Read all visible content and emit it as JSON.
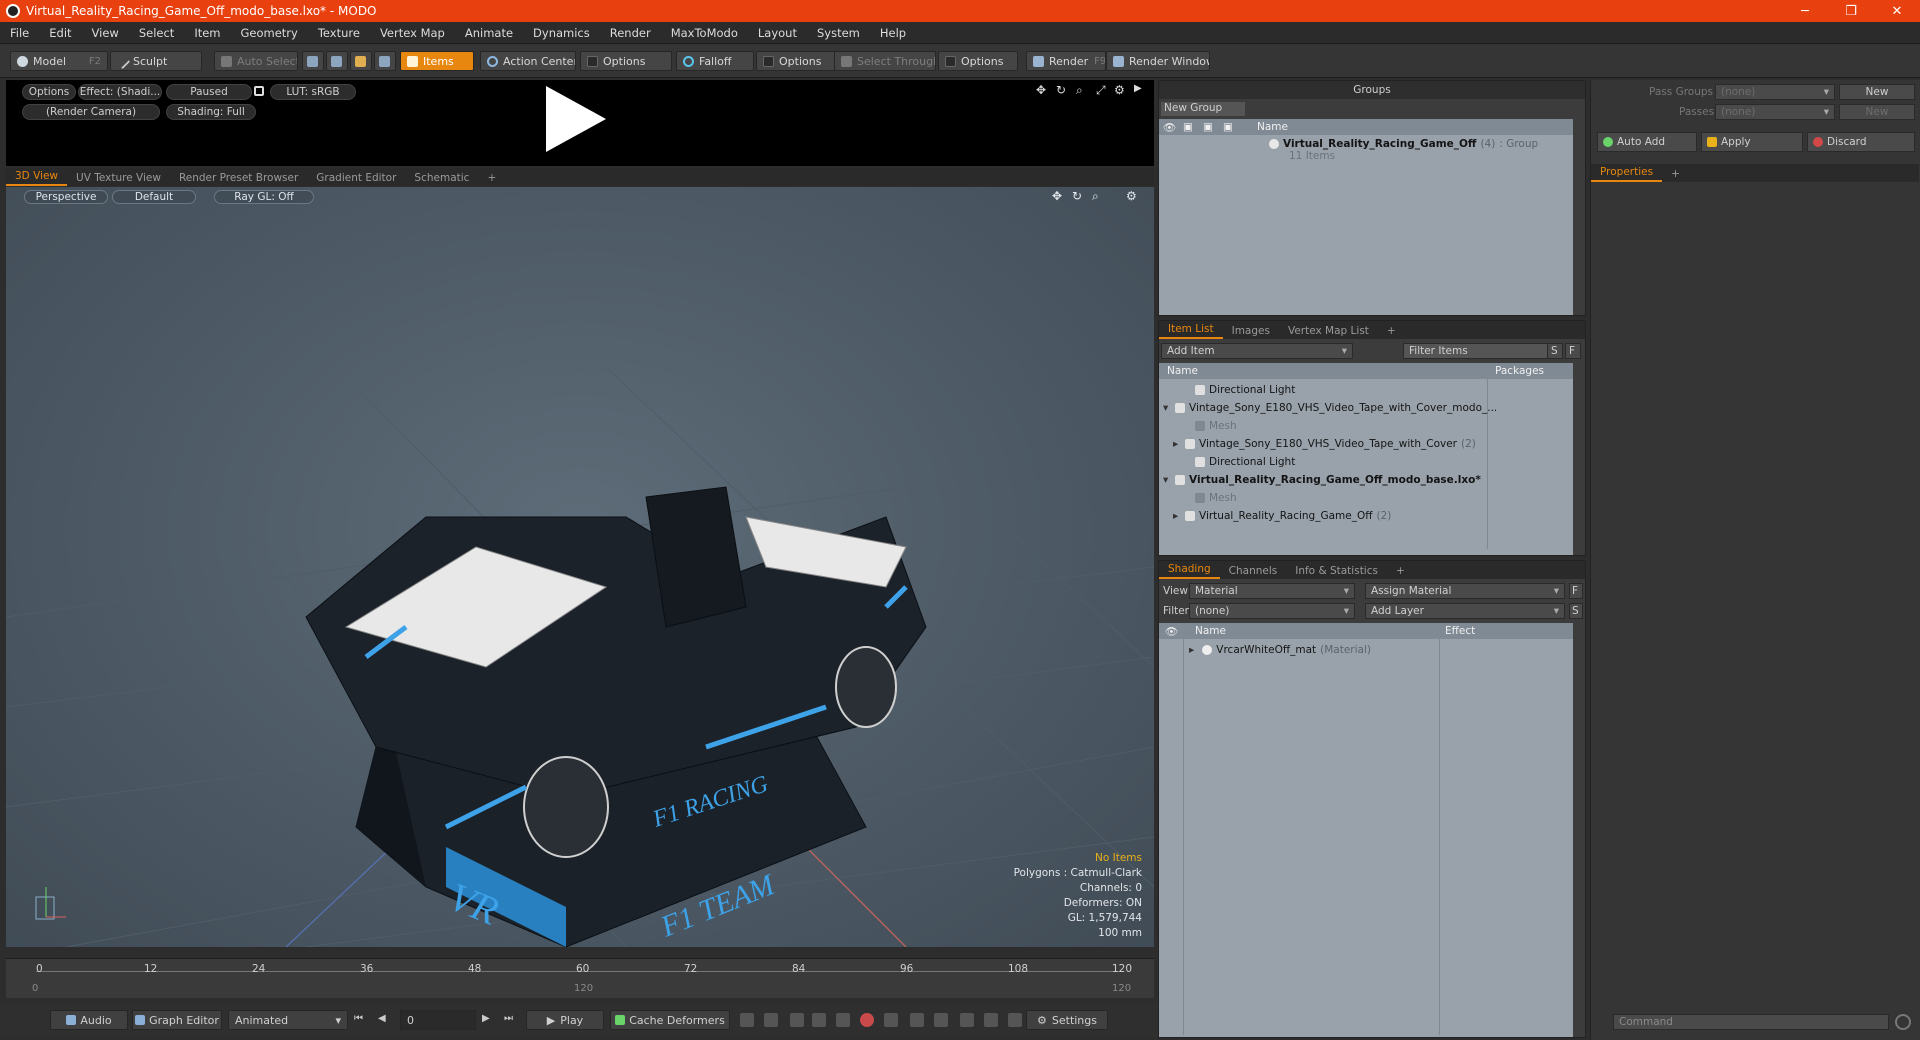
{
  "window": {
    "title": "Virtual_Reality_Racing_Game_Off_modo_base.lxo* - MODO",
    "minimize": "─",
    "maximize": "❐",
    "close": "✕"
  },
  "menu": [
    "File",
    "Edit",
    "View",
    "Select",
    "Item",
    "Geometry",
    "Texture",
    "Vertex Map",
    "Animate",
    "Dynamics",
    "Render",
    "MaxToModo",
    "Layout",
    "System",
    "Help"
  ],
  "toolbar": {
    "model": "Model",
    "model_key": "F2",
    "sculpt": "Sculpt",
    "auto_select": "Auto Select",
    "items": "Items",
    "action_center": "Action Center",
    "options1": "Options",
    "falloff": "Falloff",
    "options2": "Options",
    "select_through": "Select Through",
    "options3": "Options",
    "render": "Render",
    "render_key": "F9",
    "render_window": "Render Window"
  },
  "preview": {
    "options": "Options",
    "effect": "Effect: (Shadi...",
    "paused": "Paused",
    "lut": "LUT: sRGB",
    "camera": "(Render Camera)",
    "shading": "Shading: Full"
  },
  "view_tabs": [
    "3D View",
    "UV Texture View",
    "Render Preset Browser",
    "Gradient Editor",
    "Schematic",
    "+"
  ],
  "viewport": {
    "perspective": "Perspective",
    "default": "Default",
    "raygl": "Ray GL: Off",
    "no_items": "No Items",
    "polygons": "Polygons : Catmull-Clark",
    "channels": "Channels: 0",
    "deformers": "Deformers: ON",
    "gl": "GL: 1,579,744",
    "scale": "100 mm",
    "model_text_1": "F1 RACING",
    "model_text_2": "VR",
    "model_text_3": "F1 TEAM"
  },
  "timeline": {
    "ticks": [
      "0",
      "12",
      "24",
      "36",
      "48",
      "60",
      "72",
      "84",
      "96",
      "108",
      "120"
    ],
    "sub_start": "0",
    "sub_mid": "120",
    "sub_end": "120"
  },
  "bottom": {
    "audio": "Audio",
    "graph_editor": "Graph Editor",
    "animated": "Animated",
    "frame": "0",
    "play": "Play",
    "cache_deformers": "Cache Deformers",
    "settings": "Settings"
  },
  "groups": {
    "title": "Groups",
    "new_group": "New Group",
    "col_name": "Name",
    "group_name": "Virtual_Reality_Racing_Game_Off",
    "group_count": "(4)",
    "group_type": ": Group",
    "group_items": "11 Items"
  },
  "item_list": {
    "tabs": [
      "Item List",
      "Images",
      "Vertex Map List",
      "+"
    ],
    "add_item": "Add Item",
    "filter": "Filter Items",
    "s": "S",
    "f": "F",
    "col_name": "Name",
    "col_packages": "Packages",
    "rows": [
      {
        "label": "Directional Light",
        "indent": 2,
        "style": "normal",
        "arrow": ""
      },
      {
        "label": "Vintage_Sony_E180_VHS_Video_Tape_with_Cover_modo_...",
        "indent": 0,
        "style": "normal",
        "arrow": "▾"
      },
      {
        "label": "Mesh",
        "indent": 2,
        "style": "grey",
        "arrow": ""
      },
      {
        "label": "Vintage_Sony_E180_VHS_Video_Tape_with_Cover",
        "indent": 1,
        "style": "normal",
        "arrow": "▸",
        "suffix": "(2)"
      },
      {
        "label": "Directional Light",
        "indent": 2,
        "style": "normal",
        "arrow": ""
      },
      {
        "label": "Virtual_Reality_Racing_Game_Off_modo_base.lxo*",
        "indent": 0,
        "style": "bold",
        "arrow": "▾"
      },
      {
        "label": "Mesh",
        "indent": 2,
        "style": "grey",
        "arrow": ""
      },
      {
        "label": "Virtual_Reality_Racing_Game_Off",
        "indent": 1,
        "style": "normal",
        "arrow": "▸",
        "suffix": "(2)"
      }
    ]
  },
  "shading": {
    "tabs": [
      "Shading",
      "Channels",
      "Info & Statistics",
      "+"
    ],
    "view_label": "View",
    "view_value": "Material",
    "assign": "Assign Material",
    "filter_label": "Filter",
    "filter_value": "(none)",
    "add_layer": "Add Layer",
    "col_name": "Name",
    "col_effect": "Effect",
    "material": "VrcarWhiteOff_mat",
    "material_type": "(Material)",
    "f": "F",
    "s": "S"
  },
  "right": {
    "pass_groups": "Pass Groups",
    "pass_groups_val": "(none)",
    "passes": "Passes",
    "passes_val": "(none)",
    "new1": "New",
    "new2": "New",
    "auto_add": "Auto Add",
    "apply": "Apply",
    "discard": "Discard",
    "properties": "Properties",
    "plus": "+",
    "command": "Command"
  }
}
